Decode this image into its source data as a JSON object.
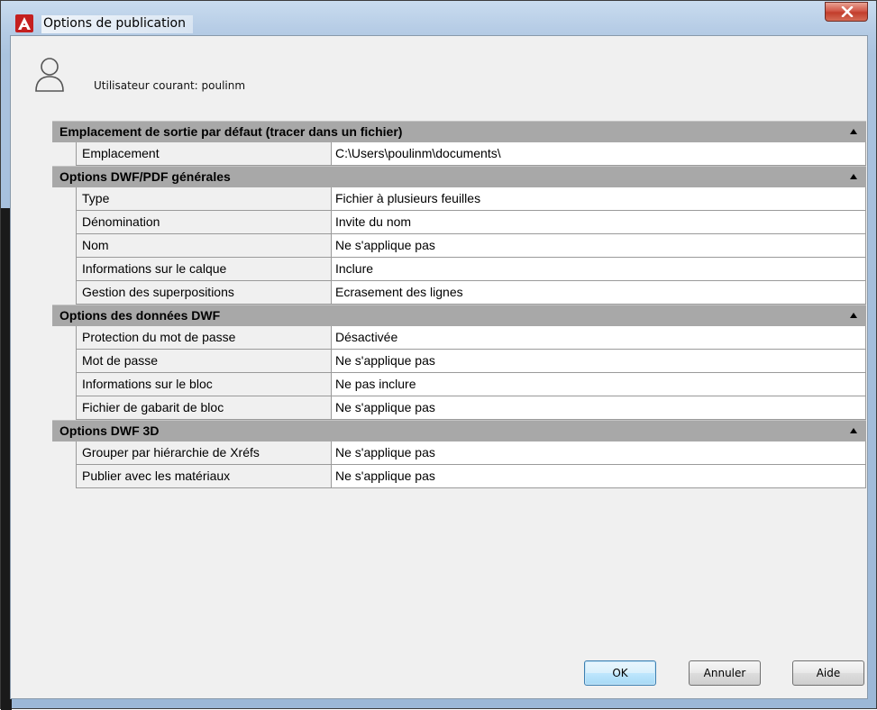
{
  "window": {
    "title": "Options de publication",
    "close_glyph": "✕"
  },
  "user": {
    "label": "Utilisateur courant: poulinm",
    "icon": "user-icon"
  },
  "sections": [
    {
      "title": "Emplacement de sortie par défaut (tracer dans un fichier)",
      "rows": [
        {
          "name": "Emplacement",
          "value": "C:\\Users\\poulinm\\documents\\"
        }
      ]
    },
    {
      "title": "Options DWF/PDF générales",
      "rows": [
        {
          "name": "Type",
          "value": "Fichier à plusieurs feuilles"
        },
        {
          "name": "Dénomination",
          "value": "Invite du nom"
        },
        {
          "name": "Nom",
          "value": "Ne s'applique pas"
        },
        {
          "name": "Informations sur le calque",
          "value": "Inclure"
        },
        {
          "name": "Gestion des superpositions",
          "value": "Ecrasement des lignes"
        }
      ]
    },
    {
      "title": "Options des données DWF",
      "rows": [
        {
          "name": "Protection du mot de passe",
          "value": "Désactivée"
        },
        {
          "name": "Mot de passe",
          "value": "Ne s'applique pas"
        },
        {
          "name": "Informations sur le bloc",
          "value": "Ne pas inclure"
        },
        {
          "name": "Fichier de gabarit de bloc",
          "value": "Ne s'applique pas"
        }
      ]
    },
    {
      "title": "Options DWF 3D",
      "rows": [
        {
          "name": "Grouper par hiérarchie de Xréfs",
          "value": "Ne s'applique pas"
        },
        {
          "name": "Publier avec les matériaux",
          "value": "Ne s'applique pas"
        }
      ]
    }
  ],
  "buttons": {
    "ok": "OK",
    "cancel": "Annuler",
    "help": "Aide"
  },
  "colors": {
    "section_header": "#a8a8a8",
    "app_icon": "#c41f1f",
    "close_button": "#c23d2b"
  }
}
